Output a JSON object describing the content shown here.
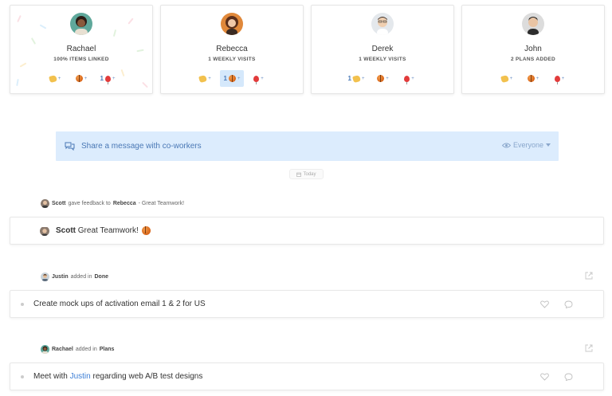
{
  "colors": {
    "accent": "#3d7fd6",
    "share_bg": "#dcecfd",
    "active_reaction_bg": "#d5e8fb"
  },
  "team": [
    {
      "name": "Rachael",
      "stat": "100% ITEMS LINKED",
      "reactions": [
        {
          "icon": "clap-emoji",
          "count": ""
        },
        {
          "icon": "basketball-emoji",
          "count": ""
        },
        {
          "icon": "balloon-emoji",
          "count": "1"
        }
      ]
    },
    {
      "name": "Rebecca",
      "stat": "1 WEEKLY VISITS",
      "reactions": [
        {
          "icon": "clap-emoji",
          "count": ""
        },
        {
          "icon": "basketball-emoji",
          "count": "1",
          "active": true
        },
        {
          "icon": "balloon-emoji",
          "count": ""
        }
      ]
    },
    {
      "name": "Derek",
      "stat": "1 WEEKLY VISITS",
      "reactions": [
        {
          "icon": "clap-emoji",
          "count": "1"
        },
        {
          "icon": "basketball-emoji",
          "count": ""
        },
        {
          "icon": "balloon-emoji",
          "count": ""
        }
      ]
    },
    {
      "name": "John",
      "stat": "2 PLANS ADDED",
      "reactions": [
        {
          "icon": "clap-emoji",
          "count": ""
        },
        {
          "icon": "basketball-emoji",
          "count": ""
        },
        {
          "icon": "balloon-emoji",
          "count": ""
        }
      ]
    }
  ],
  "reaction_add_symbol": "+",
  "share": {
    "placeholder": "Share a message with co-workers",
    "audience": "Everyone"
  },
  "date_label": "Today",
  "feed": {
    "feedback": {
      "actor": "Scott",
      "verb": "gave feedback to",
      "target": "Rebecca",
      "summary": "- Great Teamwork!",
      "card_name": "Scott",
      "card_text": "Great Teamwork!"
    },
    "item1": {
      "actor": "Justin",
      "verb": "added in",
      "list": "Done",
      "text": "Create mock ups of activation email 1 & 2 for US"
    },
    "item2": {
      "actor": "Rachael",
      "verb": "added in",
      "list": "Plans",
      "text_before": "Meet with",
      "mention": "Justin",
      "text_after": "regarding web A/B test designs"
    }
  }
}
